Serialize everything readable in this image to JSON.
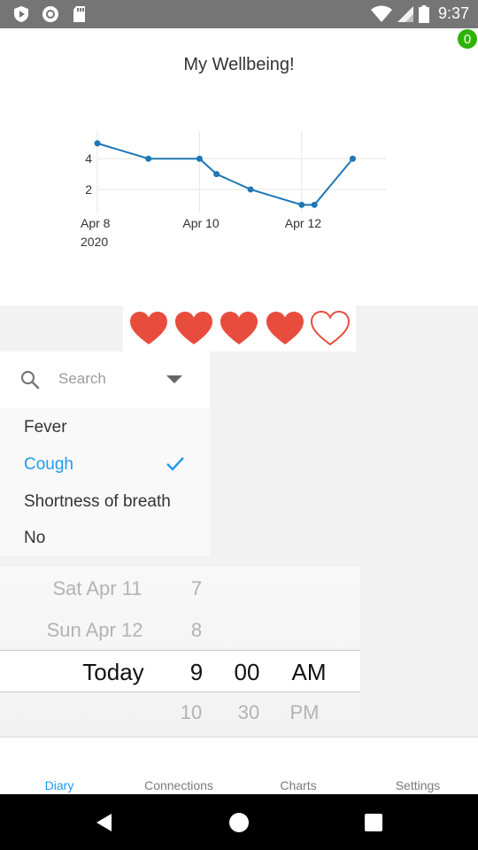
{
  "status_bar": {
    "time": "9:37",
    "icons": [
      "play-shield-icon",
      "record-icon",
      "sd-card-icon",
      "wifi-icon",
      "signal-icon",
      "battery-icon"
    ]
  },
  "badge": {
    "count": "0",
    "color": "#2db300"
  },
  "chart": {
    "title": "My Wellbeing!"
  },
  "chart_data": {
    "type": "line",
    "title": "My Wellbeing!",
    "x": [
      "2020-04-08",
      "2020-04-09",
      "2020-04-10",
      "2020-04-10T08:00",
      "2020-04-11",
      "2020-04-12",
      "2020-04-12T06:00",
      "2020-04-13"
    ],
    "series": [
      {
        "values": [
          5,
          4,
          4,
          3,
          2,
          1,
          1,
          4
        ]
      }
    ],
    "x_ticks": [
      {
        "date": "2020-04-08",
        "label": "Apr 8",
        "sub": "2020"
      },
      {
        "date": "2020-04-10",
        "label": "Apr 10",
        "sub": ""
      },
      {
        "date": "2020-04-12",
        "label": "Apr 12",
        "sub": ""
      }
    ],
    "y_ticks": [
      2,
      4
    ],
    "ylim": [
      0.5,
      5.8
    ],
    "grid": true,
    "color": "#1f77b4"
  },
  "rating": {
    "filled": 4,
    "total": 5,
    "color": "#e84c3d"
  },
  "symptoms": {
    "search_placeholder": "Search",
    "items": [
      "Fever",
      "Cough",
      "Shortness of breath",
      "No"
    ],
    "selected": "Cough",
    "accent": "#1e9bef"
  },
  "picker": {
    "dates": [
      "Sat Apr 11",
      "Sun Apr 12",
      "Today"
    ],
    "hours": [
      "7",
      "8",
      "9",
      "10"
    ],
    "minutes": [
      "00",
      "30"
    ],
    "periods": [
      "AM",
      "PM"
    ]
  },
  "tabs": {
    "diary": "Diary",
    "connections": "Connections",
    "charts": "Charts",
    "settings": "Settings",
    "active": "Diary"
  }
}
